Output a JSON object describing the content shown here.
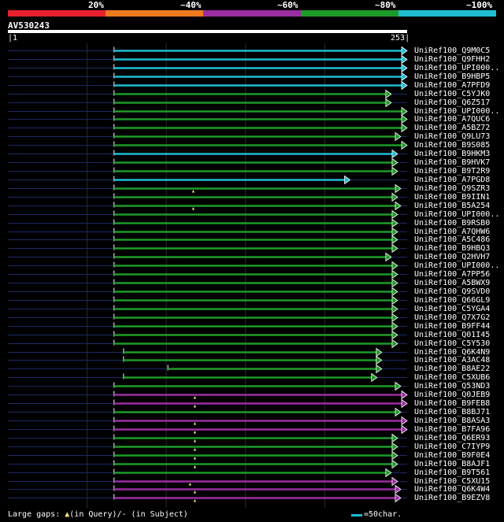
{
  "query_id": "AV530243",
  "scale": {
    "start": "1",
    "end": "253"
  },
  "identity_bands": [
    {
      "label": "20%",
      "color": "#e8202e"
    },
    {
      "label": "~40%",
      "color": "#ee7a1e"
    },
    {
      "label": "~60%",
      "color": "#9a2ea0"
    },
    {
      "label": "~80%",
      "color": "#1e9a28"
    },
    {
      "label": "~100%",
      "color": "#1fbcd2"
    }
  ],
  "colors": {
    "cyan": "#1fbcd2",
    "green": "#1e9a28",
    "purple": "#9a2ea0",
    "query": "#1a2a66",
    "gap_marker": "#f2e87a"
  },
  "hits": [
    {
      "label": "UniRef100_Q9M0C5",
      "color": "cyan",
      "start": 68,
      "end": 253
    },
    {
      "label": "UniRef100_Q9FHH2",
      "color": "cyan",
      "start": 68,
      "end": 253
    },
    {
      "label": "UniRef100_UPI000..",
      "color": "cyan",
      "start": 68,
      "end": 253
    },
    {
      "label": "UniRef100_B9HBP5",
      "color": "cyan",
      "start": 68,
      "end": 253
    },
    {
      "label": "UniRef100_A7PFD9",
      "color": "cyan",
      "start": 68,
      "end": 253
    },
    {
      "label": "UniRef100_C5YJK0",
      "color": "green",
      "start": 68,
      "end": 243
    },
    {
      "label": "UniRef100_Q6Z517",
      "color": "green",
      "start": 68,
      "end": 243
    },
    {
      "label": "UniRef100_UPI000..",
      "color": "green",
      "start": 68,
      "end": 253
    },
    {
      "label": "UniRef100_A7QUC6",
      "color": "green",
      "start": 68,
      "end": 253
    },
    {
      "label": "UniRef100_A5BZ72",
      "color": "green",
      "start": 68,
      "end": 253
    },
    {
      "label": "UniRef100_Q9LU73",
      "color": "green",
      "start": 68,
      "end": 249
    },
    {
      "label": "UniRef100_B9S085",
      "color": "green",
      "start": 68,
      "end": 253
    },
    {
      "label": "UniRef100_B9HKM3",
      "color": "cyan",
      "start": 68,
      "end": 247
    },
    {
      "label": "UniRef100_B9HVK7",
      "color": "green",
      "start": 68,
      "end": 247
    },
    {
      "label": "UniRef100_B9T2R9",
      "color": "green",
      "start": 68,
      "end": 247
    },
    {
      "label": "UniRef100_A7PGD8",
      "color": "cyan",
      "start": 68,
      "end": 217
    },
    {
      "label": "UniRef100_Q9SZR3",
      "color": "green",
      "start": 68,
      "end": 249,
      "gap": 118
    },
    {
      "label": "UniRef100_B9IIN1",
      "color": "green",
      "start": 68,
      "end": 247
    },
    {
      "label": "UniRef100_B5A254",
      "color": "green",
      "start": 68,
      "end": 249,
      "gap": 118
    },
    {
      "label": "UniRef100_UPI000..",
      "color": "green",
      "start": 68,
      "end": 247
    },
    {
      "label": "UniRef100_B9RSB0",
      "color": "green",
      "start": 68,
      "end": 247
    },
    {
      "label": "UniRef100_A7QHW6",
      "color": "green",
      "start": 68,
      "end": 247
    },
    {
      "label": "UniRef100_A5C486",
      "color": "green",
      "start": 68,
      "end": 247
    },
    {
      "label": "UniRef100_B9HBQ3",
      "color": "green",
      "start": 68,
      "end": 247
    },
    {
      "label": "UniRef100_Q2HVH7",
      "color": "green",
      "start": 68,
      "end": 243
    },
    {
      "label": "UniRef100_UPI000..",
      "color": "green",
      "start": 68,
      "end": 247
    },
    {
      "label": "UniRef100_A7PP56",
      "color": "green",
      "start": 68,
      "end": 247
    },
    {
      "label": "UniRef100_A5BWX9",
      "color": "green",
      "start": 68,
      "end": 247
    },
    {
      "label": "UniRef100_Q9SVD0",
      "color": "green",
      "start": 68,
      "end": 247
    },
    {
      "label": "UniRef100_Q66GL9",
      "color": "green",
      "start": 68,
      "end": 247
    },
    {
      "label": "UniRef100_C5YGA4",
      "color": "green",
      "start": 68,
      "end": 247
    },
    {
      "label": "UniRef100_Q7X7G2",
      "color": "green",
      "start": 68,
      "end": 247
    },
    {
      "label": "UniRef100_B9FF44",
      "color": "green",
      "start": 68,
      "end": 247
    },
    {
      "label": "UniRef100_Q01I45",
      "color": "green",
      "start": 68,
      "end": 247
    },
    {
      "label": "UniRef100_C5Y530",
      "color": "green",
      "start": 68,
      "end": 247
    },
    {
      "label": "UniRef100_Q6K4N9",
      "color": "green",
      "start": 74,
      "end": 237
    },
    {
      "label": "UniRef100_A3AC48",
      "color": "green",
      "start": 74,
      "end": 237
    },
    {
      "label": "UniRef100_B8AE22",
      "color": "green",
      "start": 102,
      "end": 237
    },
    {
      "label": "UniRef100_C5XUB6",
      "color": "green",
      "start": 74,
      "end": 234
    },
    {
      "label": "UniRef100_Q53ND3",
      "color": "green",
      "start": 68,
      "end": 249
    },
    {
      "label": "UniRef100_Q0JEB9",
      "color": "purple",
      "start": 68,
      "end": 253,
      "gap": 119
    },
    {
      "label": "UniRef100_B9FEB8",
      "color": "purple",
      "start": 68,
      "end": 253,
      "gap": 119
    },
    {
      "label": "UniRef100_B8BJ71",
      "color": "green",
      "start": 68,
      "end": 249
    },
    {
      "label": "UniRef100_B8ASA3",
      "color": "purple",
      "start": 68,
      "end": 253,
      "gap": 119
    },
    {
      "label": "UniRef100_B7FA96",
      "color": "purple",
      "start": 68,
      "end": 253,
      "gap": 119
    },
    {
      "label": "UniRef100_Q6ER93",
      "color": "green",
      "start": 68,
      "end": 247,
      "gap": 119
    },
    {
      "label": "UniRef100_C7IYP9",
      "color": "green",
      "start": 68,
      "end": 247,
      "gap": 119
    },
    {
      "label": "UniRef100_B9F0E4",
      "color": "green",
      "start": 68,
      "end": 247,
      "gap": 119
    },
    {
      "label": "UniRef100_B8AJF1",
      "color": "green",
      "start": 68,
      "end": 247,
      "gap": 119
    },
    {
      "label": "UniRef100_B9T561",
      "color": "green",
      "start": 68,
      "end": 243
    },
    {
      "label": "UniRef100_C5XU15",
      "color": "purple",
      "start": 68,
      "end": 247,
      "gap": 116
    },
    {
      "label": "UniRef100_Q6K4W4",
      "color": "purple",
      "start": 68,
      "end": 249,
      "gap": 119
    },
    {
      "label": "UniRef100_B9EZV8",
      "color": "purple",
      "start": 68,
      "end": 249,
      "gap": 119
    }
  ],
  "legend": {
    "gaps_prefix": "Large gaps: ",
    "gaps_query": "(in Query)/",
    "gaps_subject": "- (in Subject)",
    "scale_label": "=50char."
  }
}
